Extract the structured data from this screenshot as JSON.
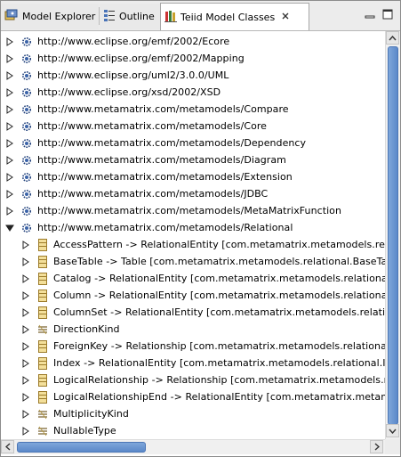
{
  "tabs": [
    {
      "label": "Model Explorer",
      "icon": "model-explorer-icon",
      "active": false
    },
    {
      "label": "Outline",
      "icon": "outline-icon",
      "active": false
    },
    {
      "label": "Teiid Model Classes",
      "icon": "model-classes-icon",
      "active": true
    }
  ],
  "tree": {
    "packages": [
      "http://www.eclipse.org/emf/2002/Ecore",
      "http://www.eclipse.org/emf/2002/Mapping",
      "http://www.eclipse.org/uml2/3.0.0/UML",
      "http://www.eclipse.org/xsd/2002/XSD",
      "http://www.metamatrix.com/metamodels/Compare",
      "http://www.metamatrix.com/metamodels/Core",
      "http://www.metamatrix.com/metamodels/Dependency",
      "http://www.metamatrix.com/metamodels/Diagram",
      "http://www.metamatrix.com/metamodels/Extension",
      "http://www.metamatrix.com/metamodels/JDBC",
      "http://www.metamatrix.com/metamodels/MetaMatrixFunction",
      "http://www.metamatrix.com/metamodels/Relational"
    ],
    "expanded_package": "http://www.metamatrix.com/metamodels/Relational",
    "children": [
      {
        "label": "AccessPattern -> RelationalEntity [com.metamatrix.metamodels.relational.AccessPattern]",
        "kind": "class"
      },
      {
        "label": "BaseTable -> Table [com.metamatrix.metamodels.relational.BaseTable]",
        "kind": "class"
      },
      {
        "label": "Catalog -> RelationalEntity [com.metamatrix.metamodels.relational.Catalog]",
        "kind": "class"
      },
      {
        "label": "Column -> RelationalEntity [com.metamatrix.metamodels.relational.Column]",
        "kind": "class"
      },
      {
        "label": "ColumnSet -> RelationalEntity [com.metamatrix.metamodels.relational.ColumnSet]",
        "kind": "class"
      },
      {
        "label": "DirectionKind",
        "kind": "enum"
      },
      {
        "label": "ForeignKey -> Relationship [com.metamatrix.metamodels.relational.ForeignKey]",
        "kind": "class"
      },
      {
        "label": "Index -> RelationalEntity [com.metamatrix.metamodels.relational.Index]",
        "kind": "class"
      },
      {
        "label": "LogicalRelationship -> Relationship [com.metamatrix.metamodels.relational.LogicalRelationship]",
        "kind": "class"
      },
      {
        "label": "LogicalRelationshipEnd -> RelationalEntity [com.metamatrix.metamodels.relational.LogicalRelationshipEnd]",
        "kind": "class"
      },
      {
        "label": "MultiplicityKind",
        "kind": "enum"
      },
      {
        "label": "NullableType",
        "kind": "enum"
      }
    ]
  },
  "colors": {
    "scroll_thumb": "#6a95d2",
    "tab_active_bg": "#ffffff",
    "tab_bar_bg": "#ececec"
  }
}
